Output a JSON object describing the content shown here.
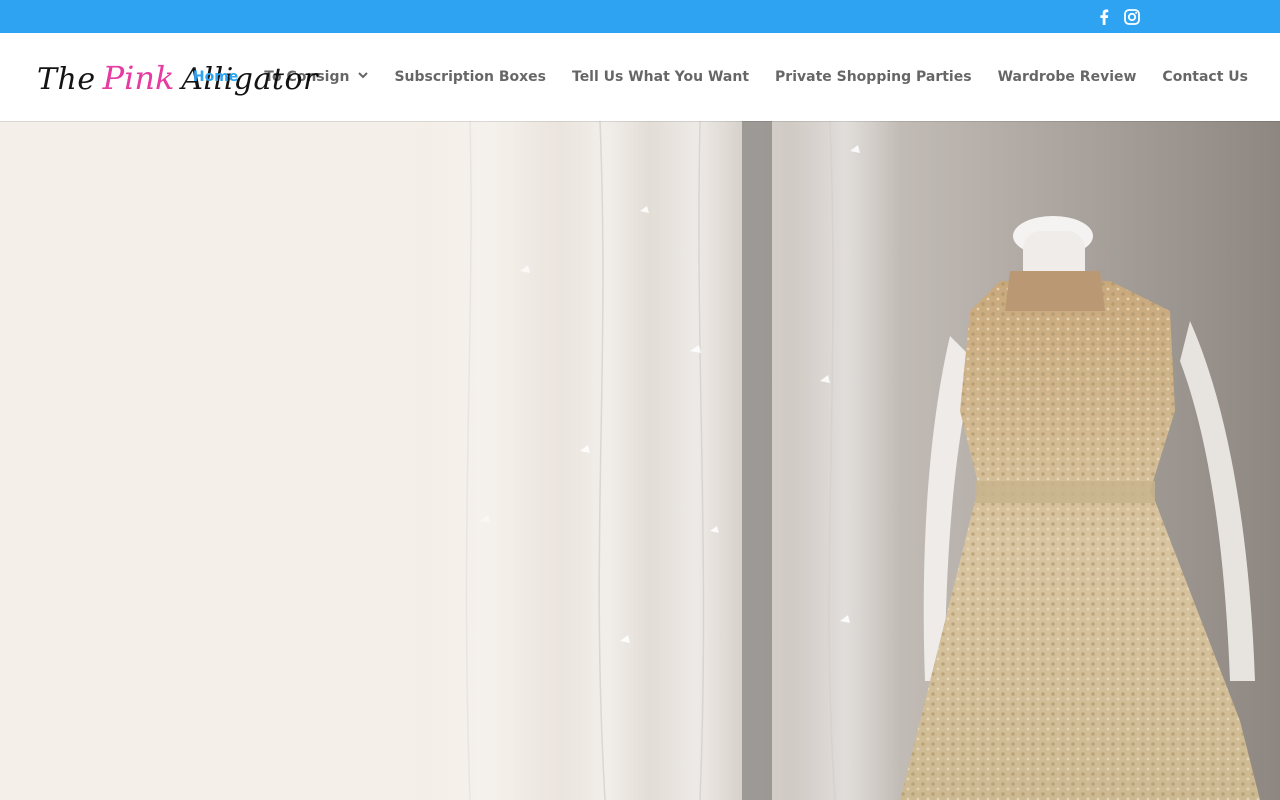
{
  "topbar": {
    "background": "#2ea3f2",
    "social_icons": [
      "facebook-icon",
      "instagram-icon"
    ]
  },
  "header": {
    "logo": {
      "word1": "The",
      "word2": "Pink",
      "word3": "Alligator",
      "pink_color": "#e63ba0"
    },
    "nav": {
      "active_color": "#2ea3f2",
      "items": [
        {
          "label": "Home",
          "active": true
        },
        {
          "label": "To Consign",
          "dropdown": true
        },
        {
          "label": "Subscription Boxes"
        },
        {
          "label": "Tell Us What You Want"
        },
        {
          "label": "Private Shopping Parties"
        },
        {
          "label": "Wardrobe Review"
        },
        {
          "label": "Contact Us"
        }
      ]
    }
  },
  "hero": {
    "image": "mannequin-dress-photo"
  }
}
